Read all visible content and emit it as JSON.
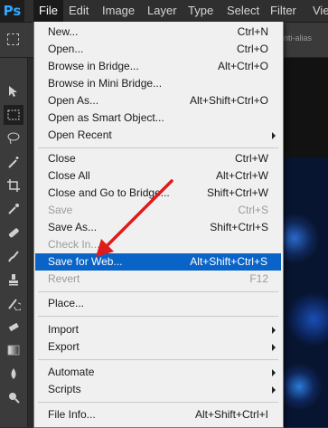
{
  "menubar": {
    "logo": "Ps",
    "items": [
      {
        "label": "File",
        "active": true
      },
      {
        "label": "Edit"
      },
      {
        "label": "Image"
      },
      {
        "label": "Layer"
      },
      {
        "label": "Type"
      },
      {
        "label": "Select"
      },
      {
        "label": "Filter"
      },
      {
        "label": "View"
      }
    ]
  },
  "options_bar": {
    "partial_text": "nti-alias"
  },
  "file_menu": {
    "items": [
      {
        "label": "New...",
        "shortcut": "Ctrl+N"
      },
      {
        "label": "Open...",
        "shortcut": "Ctrl+O"
      },
      {
        "label": "Browse in Bridge...",
        "shortcut": "Alt+Ctrl+O"
      },
      {
        "label": "Browse in Mini Bridge...",
        "shortcut": ""
      },
      {
        "label": "Open As...",
        "shortcut": "Alt+Shift+Ctrl+O"
      },
      {
        "label": "Open as Smart Object...",
        "shortcut": ""
      },
      {
        "label": "Open Recent",
        "shortcut": "",
        "submenu": true
      },
      {
        "label": "Close",
        "shortcut": "Ctrl+W"
      },
      {
        "label": "Close All",
        "shortcut": "Alt+Ctrl+W"
      },
      {
        "label": "Close and Go to Bridge...",
        "shortcut": "Shift+Ctrl+W"
      },
      {
        "label": "Save",
        "shortcut": "Ctrl+S",
        "disabled": true
      },
      {
        "label": "Save As...",
        "shortcut": "Shift+Ctrl+S"
      },
      {
        "label": "Check In...",
        "shortcut": "",
        "disabled": true
      },
      {
        "label": "Save for Web...",
        "shortcut": "Alt+Shift+Ctrl+S",
        "highlighted": true
      },
      {
        "label": "Revert",
        "shortcut": "F12",
        "disabled": true
      },
      {
        "label": "Place...",
        "shortcut": ""
      },
      {
        "label": "Import",
        "shortcut": "",
        "submenu": true
      },
      {
        "label": "Export",
        "shortcut": "",
        "submenu": true
      },
      {
        "label": "Automate",
        "shortcut": "",
        "submenu": true
      },
      {
        "label": "Scripts",
        "shortcut": "",
        "submenu": true
      },
      {
        "label": "File Info...",
        "shortcut": "Alt+Shift+Ctrl+I"
      }
    ]
  },
  "colors": {
    "highlight": "#0a64c7",
    "annotation_arrow": "#e01b1b"
  },
  "tools": [
    {
      "icon": "move-tool-icon"
    },
    {
      "icon": "rectangular-marquee-icon",
      "selected": true
    },
    {
      "icon": "lasso-icon"
    },
    {
      "icon": "magic-wand-icon"
    },
    {
      "icon": "crop-icon"
    },
    {
      "icon": "eyedropper-icon"
    },
    {
      "icon": "healing-brush-icon"
    },
    {
      "icon": "brush-icon"
    },
    {
      "icon": "clone-stamp-icon"
    },
    {
      "icon": "history-brush-icon"
    },
    {
      "icon": "eraser-icon"
    },
    {
      "icon": "gradient-icon"
    },
    {
      "icon": "blur-icon"
    },
    {
      "icon": "dodge-icon"
    }
  ]
}
